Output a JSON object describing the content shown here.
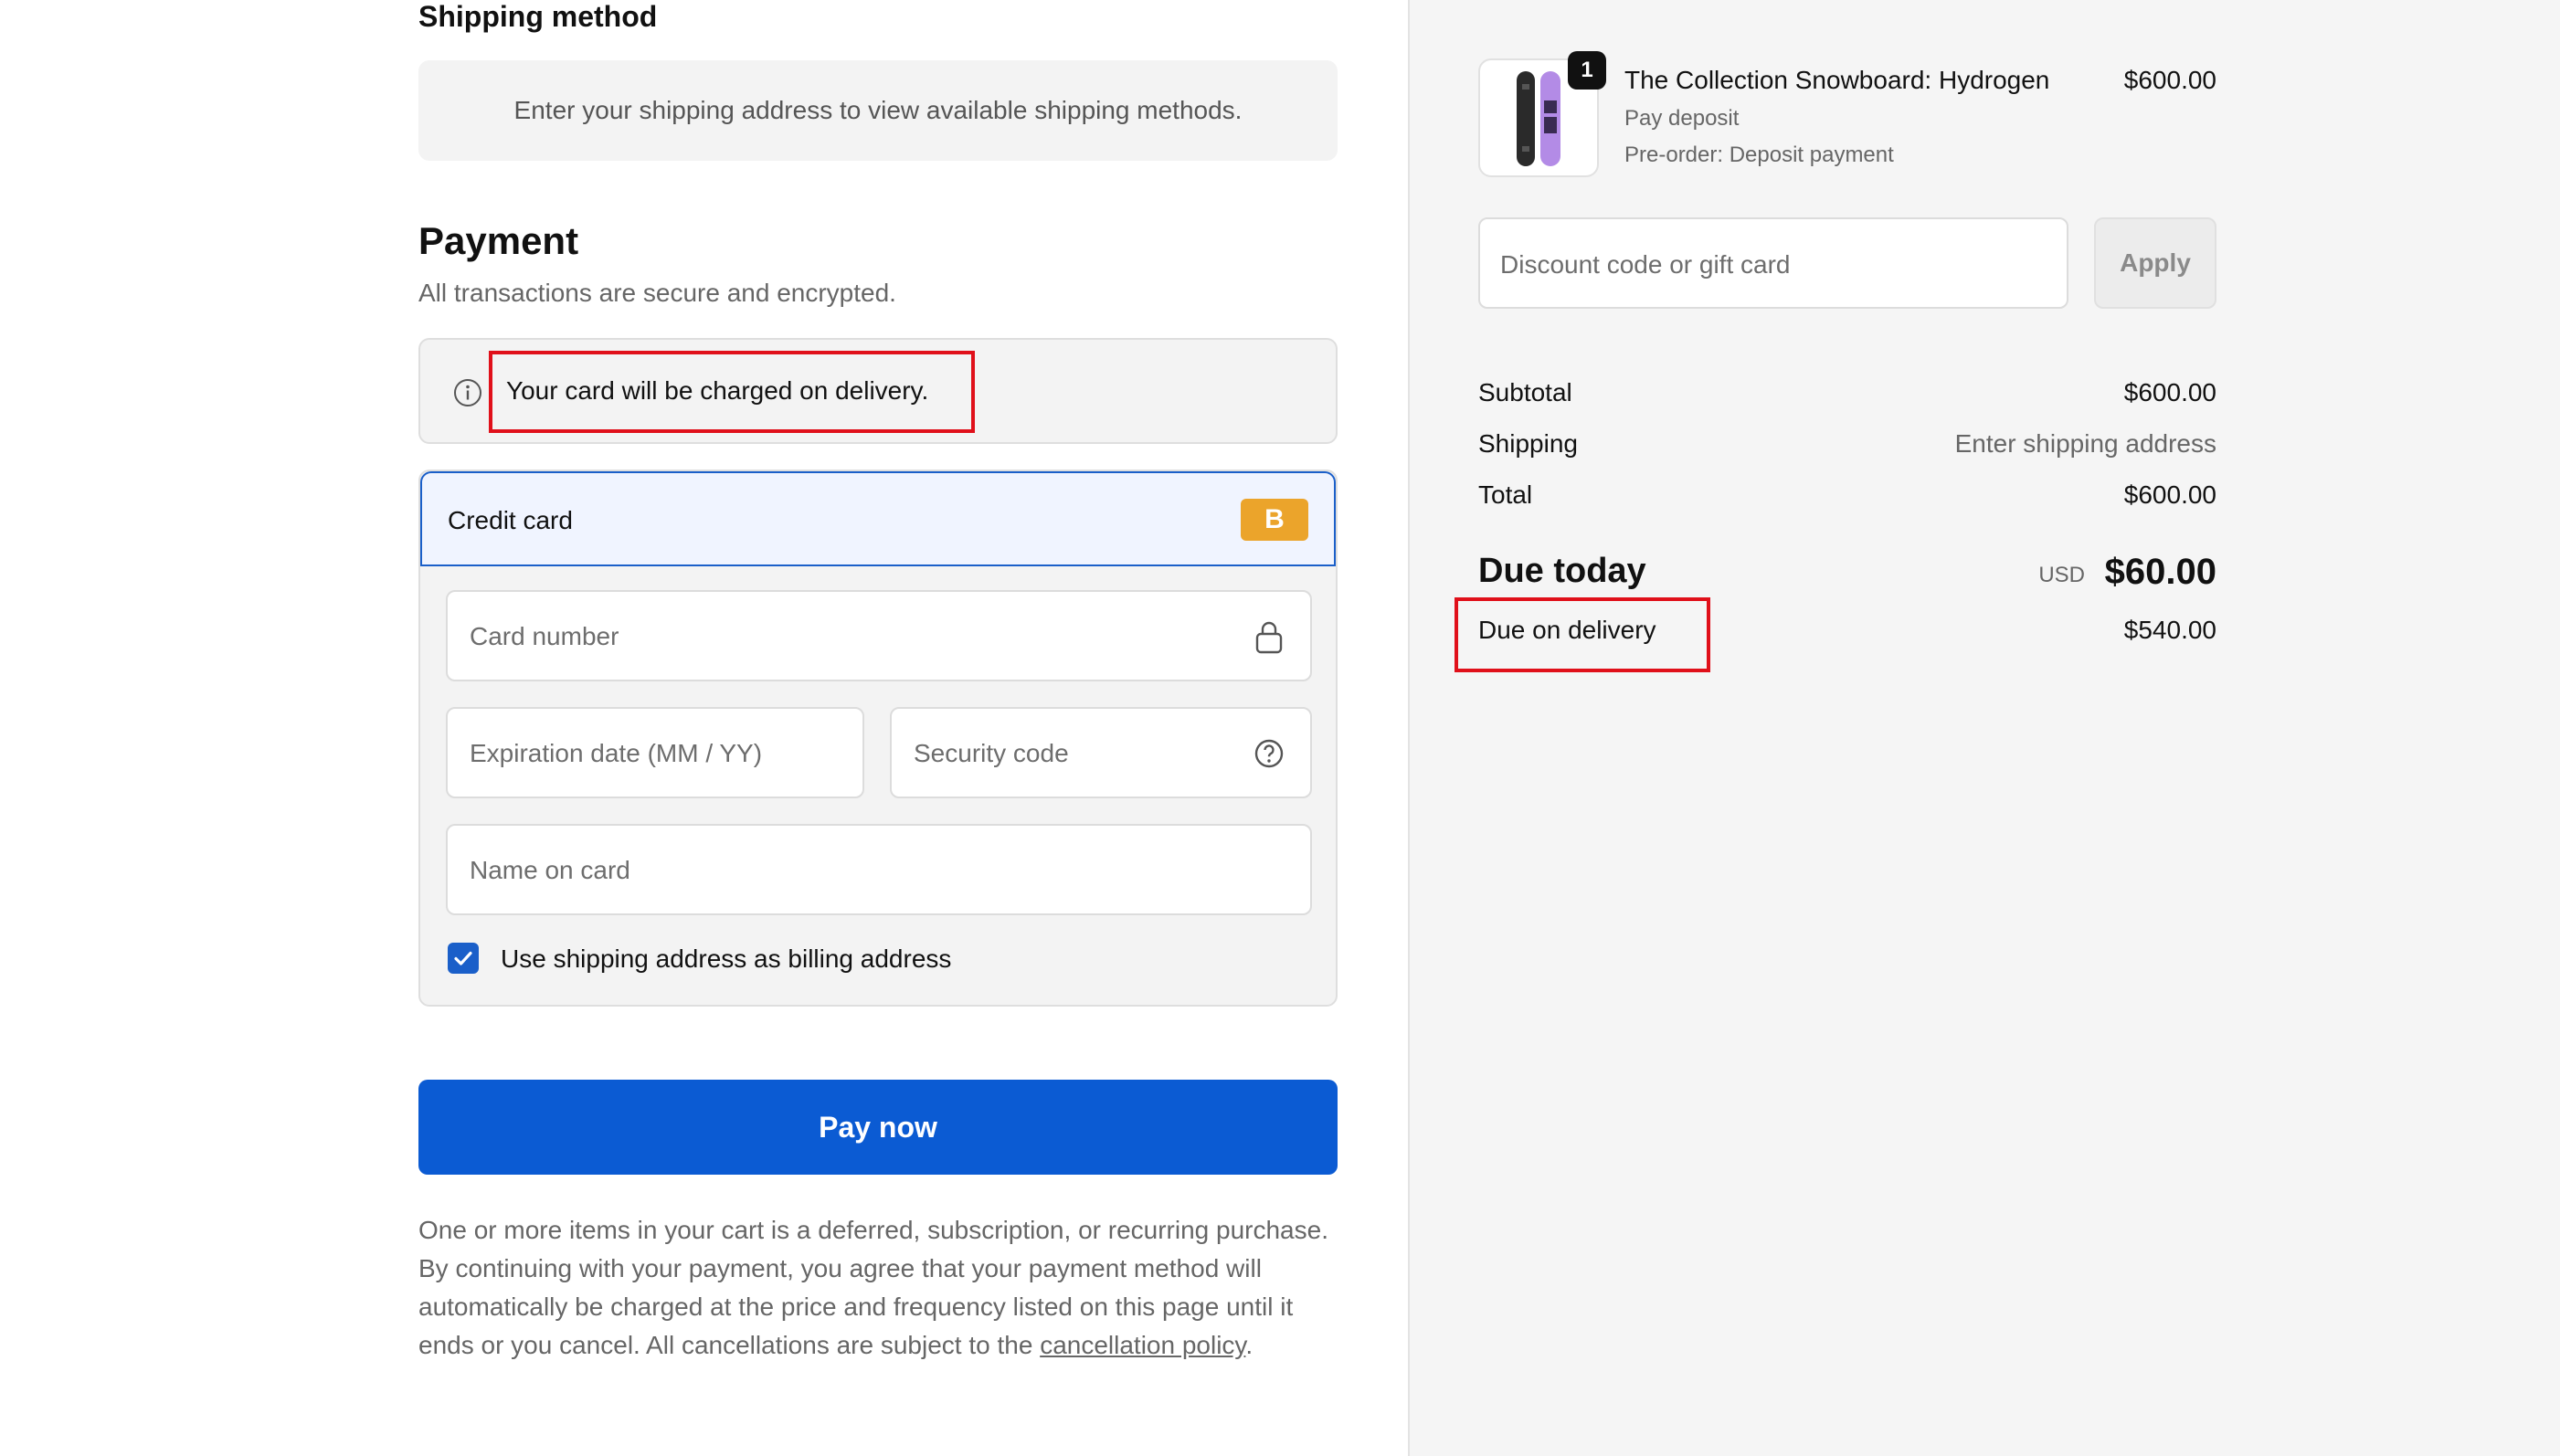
{
  "shipping": {
    "heading": "Shipping method",
    "notice": "Enter your shipping address to view available shipping methods."
  },
  "payment": {
    "heading": "Payment",
    "subtitle": "All transactions are secure and encrypted.",
    "charge_notice": "Your card will be charged on delivery.",
    "method_label": "Credit card",
    "method_badge": "B",
    "fields": {
      "card_number": "Card number",
      "expiration": "Expiration date (MM / YY)",
      "security_code": "Security code",
      "name_on_card": "Name on card"
    },
    "billing_checkbox_label": "Use shipping address as billing address",
    "billing_checked": true,
    "pay_button": "Pay now",
    "legal_text": "One or more items in your cart is a deferred, subscription, or recurring purchase. By continuing with your payment, you agree that your payment method will automatically be charged at the price and frequency listed on this page until it ends or you cancel. All cancellations are subject to the",
    "legal_link": "cancellation policy",
    "legal_end": "."
  },
  "summary": {
    "item": {
      "quantity": "1",
      "title": "The Collection Snowboard: Hydrogen",
      "line1": "Pay deposit",
      "line2": "Pre-order: Deposit payment",
      "price": "$600.00"
    },
    "discount_placeholder": "Discount code or gift card",
    "apply_label": "Apply",
    "subtotal_label": "Subtotal",
    "subtotal_value": "$600.00",
    "shipping_label": "Shipping",
    "shipping_value": "Enter shipping address",
    "total_label": "Total",
    "total_value": "$600.00",
    "due_today_label": "Due today",
    "due_today_currency": "USD",
    "due_today_value": "$60.00",
    "due_delivery_label": "Due on delivery",
    "due_delivery_value": "$540.00"
  },
  "colors": {
    "primary": "#0b5bd3",
    "highlight": "#e0101a",
    "badge": "#eba42b"
  }
}
